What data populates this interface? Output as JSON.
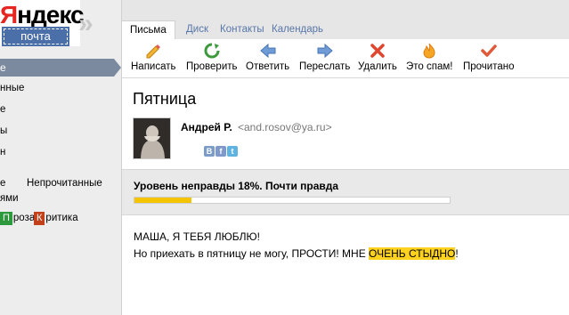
{
  "logo": {
    "first_letter": "Я",
    "rest": "ндекс",
    "service": "почта",
    "chevrons": "»"
  },
  "sidebar": {
    "folders": [
      {
        "label": "е",
        "active": true
      },
      {
        "label": "нные"
      },
      {
        "label": "е"
      },
      {
        "label": "ы"
      },
      {
        "label": "н"
      }
    ],
    "filters": {
      "left_fragment": "е",
      "unread": "Непрочитанные",
      "second_line": "ями"
    },
    "labels": [
      {
        "letter": "П",
        "text": "роза",
        "color": "#2c9a3c"
      },
      {
        "letter": "К",
        "text": "ритика",
        "color": "#c2401a"
      }
    ]
  },
  "tabs": [
    {
      "label": "Письма",
      "active": true
    },
    {
      "label": "Диск"
    },
    {
      "label": "Контакты"
    },
    {
      "label": "Календарь"
    }
  ],
  "toolbar": [
    {
      "label": "Написать",
      "icon": "compose-icon"
    },
    {
      "label": "Проверить",
      "icon": "refresh-icon"
    },
    {
      "label": "Ответить",
      "icon": "reply-icon"
    },
    {
      "label": "Переслать",
      "icon": "forward-icon"
    },
    {
      "label": "Удалить",
      "icon": "delete-icon"
    },
    {
      "label": "Это спам!",
      "icon": "spam-flame-icon"
    },
    {
      "label": "Прочитано",
      "icon": "read-check-icon"
    }
  ],
  "message": {
    "subject": "Пятница",
    "sender_name": "Андрей Р.",
    "sender_email": "<and.rosov@ya.ru>",
    "social": [
      "В",
      "f",
      "t"
    ],
    "truth": {
      "text": "Уровень неправды 18%.  Почти правда",
      "fraction": 0.18
    },
    "body": {
      "line1": "МАША, Я ТЕБЯ ЛЮБЛЮ!",
      "line2_before": "Но приехать в пятницу не могу, ПРОСТИ! МНЕ ",
      "line2_highlight": "ОЧЕНЬ СТЫДНО",
      "line2_after": "!"
    }
  },
  "colors": {
    "brand_red": "#e52620",
    "stamp_blue": "#4b6fa8",
    "active_folder": "#7c8aa0",
    "link_blue": "#5977a9",
    "highlight_yellow": "#ffd21f",
    "progress_fill": "#f5c400"
  }
}
